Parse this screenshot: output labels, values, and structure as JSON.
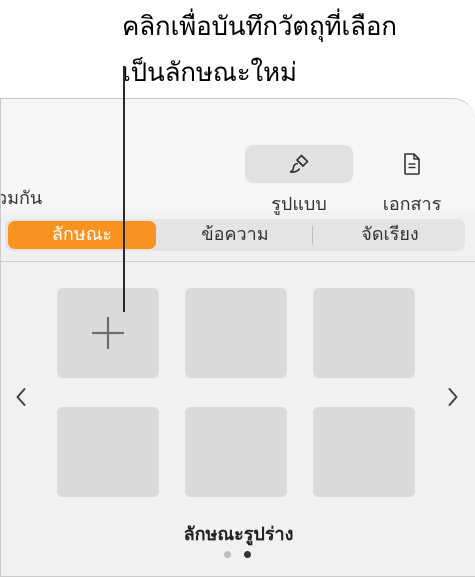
{
  "callout": {
    "line1": "คลิกเพื่อบันทึกวัตถุที่เลือก",
    "line2": "เป็นลักษณะใหม่"
  },
  "toolbar": {
    "partial_label": "วมกัน",
    "format_label": "รูปแบบ",
    "format_icon": "paintbrush-icon",
    "document_label": "เอกสาร",
    "document_icon": "document-icon"
  },
  "tabs": [
    {
      "label": "ลักษณะ",
      "selected": true
    },
    {
      "label": "ข้อความ",
      "selected": false
    },
    {
      "label": "จัดเรียง",
      "selected": false
    }
  ],
  "styles": {
    "title": "ลักษณะรูปร่าง",
    "add_icon": "plus-icon",
    "page_count": 2,
    "current_page": 2
  },
  "colors": {
    "accent": "#f7931e",
    "panel_bg": "#f1f1f1",
    "tile_bg": "#dadada"
  }
}
